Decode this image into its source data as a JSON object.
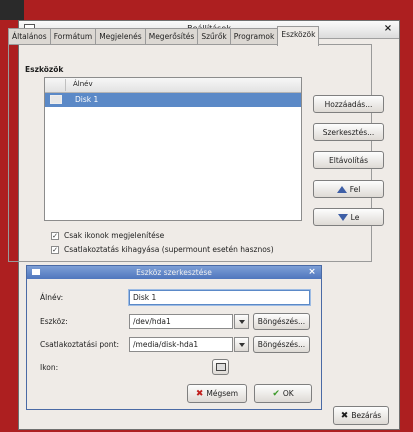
{
  "window": {
    "title": "Beállítások",
    "close_glyph": "×"
  },
  "tabs": [
    {
      "label": "Általános"
    },
    {
      "label": "Formátum"
    },
    {
      "label": "Megjelenés"
    },
    {
      "label": "Megerősítés"
    },
    {
      "label": "Szűrők"
    },
    {
      "label": "Programok"
    },
    {
      "label": "Eszközök",
      "active": true
    }
  ],
  "tools_section": {
    "title": "Eszközök",
    "column_header": "Álnév",
    "rows": [
      {
        "label": "Disk 1",
        "selected": true,
        "icon": "disk-icon"
      }
    ]
  },
  "side_buttons": {
    "add": "Hozzáadás...",
    "edit": "Szerkesztés...",
    "remove": "Eltávolítás",
    "up": "Fel",
    "down": "Le"
  },
  "options": {
    "icons_only": {
      "label": "Csak ikonok megjelenítése",
      "checked": true
    },
    "skip_mount": {
      "label": "Csatlakoztatás kihagyása (supermount esetén hasznos)",
      "checked": true
    }
  },
  "dialog": {
    "title": "Eszköz szerkesztése",
    "close_glyph": "×",
    "alias_label": "Álnév:",
    "alias_value": "Disk 1",
    "device_label": "Eszköz:",
    "device_value": "/dev/hda1",
    "mount_label": "Csatlakoztatási pont:",
    "mount_value": "/media/disk-hda1",
    "icon_label": "Ikon:",
    "browse_label": "Böngészés...",
    "cancel_label": "Mégsem",
    "ok_label": "OK"
  },
  "close_button": "Bezárás",
  "colors": {
    "background": "#ad1f20",
    "selection": "#5b89c7",
    "dialog_title": "#4f76bd"
  }
}
